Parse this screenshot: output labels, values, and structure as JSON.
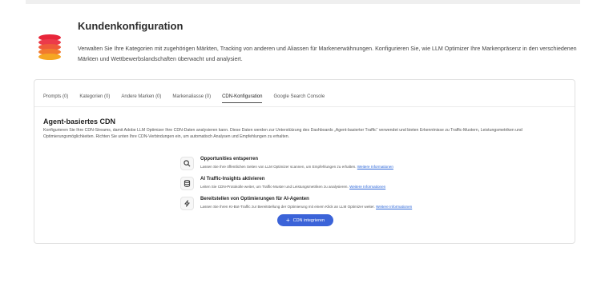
{
  "header": {
    "title": "Kundenkonfiguration",
    "description": "Verwalten Sie Ihre Kategorien mit zugehörigen Märkten, Tracking von anderen und Aliassen für Markenerwähnungen. Konfigurieren Sie, wie LLM Optimizer Ihre Markenpräsenz in den verschiedenen Märkten und Wettbewerbslandschaften überwacht und analysiert."
  },
  "tabs": [
    {
      "label": "Prompts (0)"
    },
    {
      "label": "Kategorien (0)"
    },
    {
      "label": "Andere Marken (0)"
    },
    {
      "label": "Markenaliasse (0)"
    },
    {
      "label": "CDN-Konfiguration"
    },
    {
      "label": "Google Search Console"
    }
  ],
  "active_tab": "CDN-Konfiguration",
  "section": {
    "title": "Agent-basiertes CDN",
    "description": "Konfigurieren Sie Ihre CDN-Streams, damit Adobe LLM Optimizer Ihre CDN-Daten analysieren kann. Diese Daten werden zur Unterstützung des Dashboards „Agent-basierter Traffic“ verwendet und bieten Erkenntnisse zu Traffic-Mustern, Leistungsmetriken und Optimierungsmöglichkeiten. Richten Sie unten Ihre CDN-Verbindungen ein, um automatisch Analysen und Empfehlungen zu erhalten."
  },
  "features": [
    {
      "icon": "search-icon",
      "title": "Opportunities entsperren",
      "desc": "Lassen Sie Ihre öffentlichen Seiten von LLM Optimizer scannen, um Empfehlungen zu erhalten.",
      "link": "Weitere Informationen"
    },
    {
      "icon": "database-icon",
      "title": "AI Traffic-Insights aktivieren",
      "desc": "Leiten Sie CDN-Protokolle weiter, um Traffic-Muster und Leistungsmetriken zu analysieren.",
      "link": "Weitere Informationen"
    },
    {
      "icon": "lightning-icon",
      "title": "Bereitstellen von Optimierungen für AI-Agenten",
      "desc": "Lassen Sie Ihren KI-Bot-Traffic zur Bereitstellung der Optimierung mit einem Klick an LLM Optimizer weiter.",
      "link": "Weitere Informationen"
    }
  ],
  "button": {
    "label": "CDN integrieren"
  },
  "colors": {
    "accent": "#3b63d8",
    "link": "#2b66d9",
    "logo_top": "#e8263a",
    "logo_bottom": "#f5a623"
  }
}
